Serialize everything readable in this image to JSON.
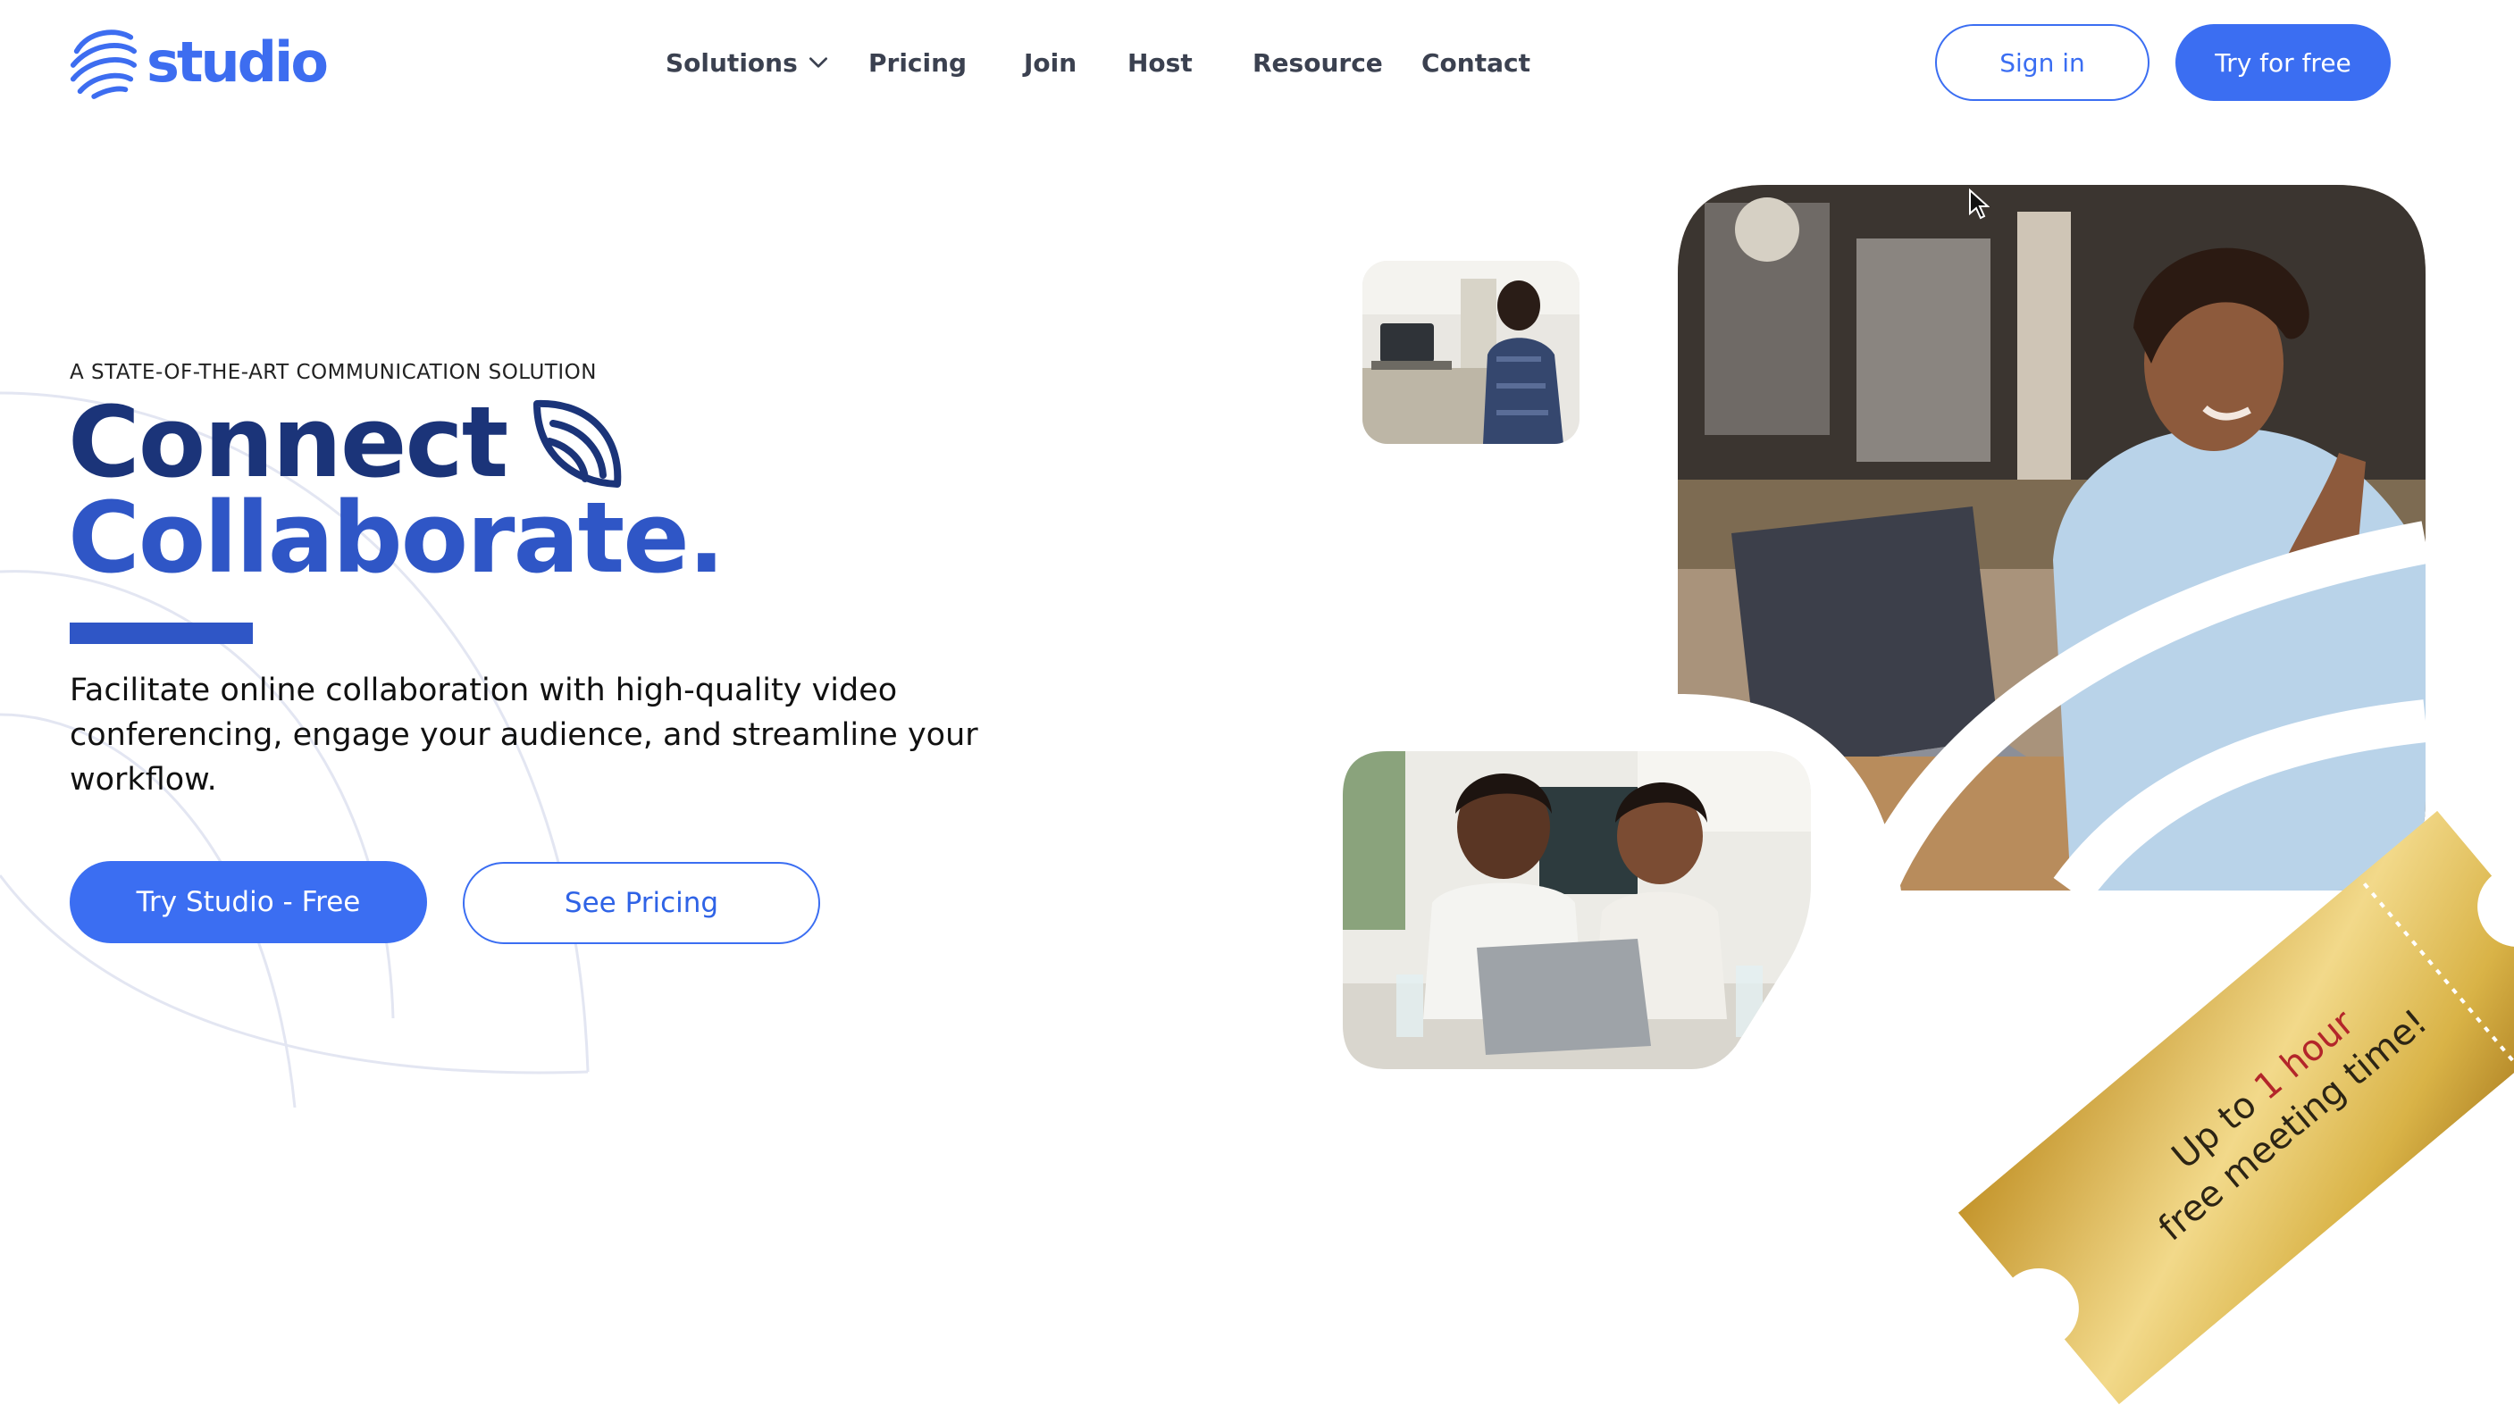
{
  "brand": {
    "name": "studio",
    "color": "#3d6df0"
  },
  "nav": {
    "items": [
      {
        "label": "Solutions",
        "has_dropdown": true
      },
      {
        "label": "Pricing"
      },
      {
        "label": "Join"
      },
      {
        "label": "Host"
      },
      {
        "label": "Resource"
      },
      {
        "label": "Contact"
      }
    ],
    "sign_in": "Sign in",
    "try_free": "Try for free"
  },
  "hero": {
    "eyebrow": "A STATE-OF-THE-ART COMMUNICATION SOLUTION",
    "headline_line1": "Connect",
    "headline_line2": "Collaborate.",
    "description": "Facilitate online collaboration with high-quality video conferencing, engage your audience, and streamline your workflow.",
    "primary_cta": "Try Studio - Free",
    "secondary_cta": "See Pricing"
  },
  "ticket": {
    "line1_prefix": "Up to ",
    "line1_highlight": "1 hour",
    "line2": "free meeting time!"
  },
  "colors": {
    "primary": "#3b6ef2",
    "headline_dark": "#1b3479",
    "headline_mid": "#2f56c6",
    "ticket_gold": "#d9b347",
    "ticket_highlight": "#b3262a"
  }
}
